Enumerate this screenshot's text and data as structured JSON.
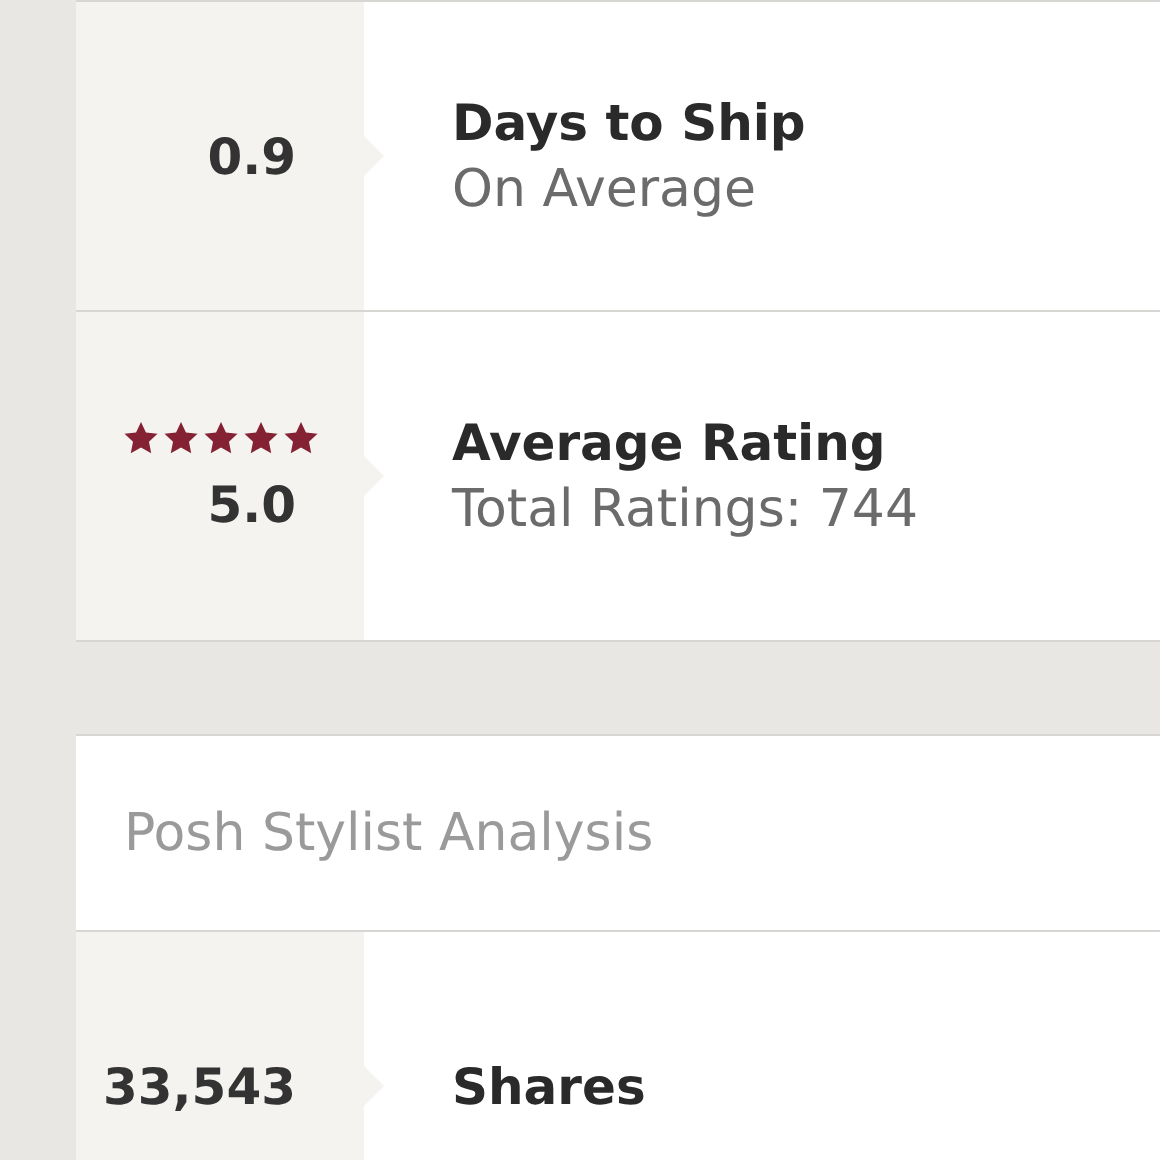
{
  "stats": [
    {
      "value": "0.9",
      "title": "Days to Ship",
      "subtitle": "On Average"
    },
    {
      "value": "5.0",
      "stars": 5,
      "title": "Average Rating",
      "subtitle": "Total Ratings: 744"
    }
  ],
  "analysis": {
    "header": "Posh Stylist Analysis",
    "rows": [
      {
        "value": "33,543",
        "title": "Shares"
      }
    ]
  }
}
